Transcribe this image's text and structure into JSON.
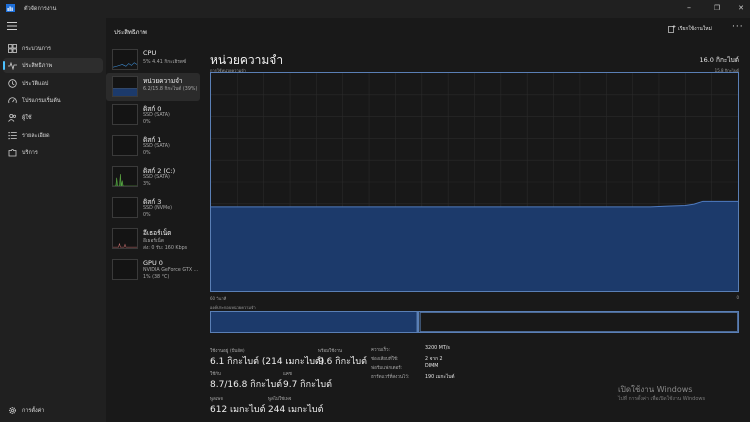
{
  "window": {
    "title": "ตัวจัดการงาน"
  },
  "nav": {
    "items": [
      {
        "label": "กระบวนการ",
        "icon": "grid-icon"
      },
      {
        "label": "ประสิทธิภาพ",
        "icon": "pulse-icon",
        "active": true
      },
      {
        "label": "ประวัติแอป",
        "icon": "history-icon"
      },
      {
        "label": "โปรแกรมเริ่มต้น",
        "icon": "speedometer-icon"
      },
      {
        "label": "ผู้ใช้",
        "icon": "users-icon"
      },
      {
        "label": "รายละเอียด",
        "icon": "list-icon"
      },
      {
        "label": "บริการ",
        "icon": "puzzle-icon"
      }
    ],
    "settings_label": "การตั้งค่า"
  },
  "header": {
    "page_title": "ประสิทธิภาพ",
    "run_task_label": "เรียกใช้งานใหม่",
    "more": "···"
  },
  "perf_list": [
    {
      "name": "CPU",
      "sub1": "5%  4.41 กิกะเฮิรตซ์",
      "sub2": ""
    },
    {
      "name": "หน่วยความจำ",
      "sub1": "6.2/15.8 กิกะไบต์ (39%)",
      "sub2": ""
    },
    {
      "name": "ดิสก์ 0",
      "sub1": "SSD (SATA)",
      "sub2": "0%"
    },
    {
      "name": "ดิสก์ 1",
      "sub1": "SSD (SATA)",
      "sub2": "0%"
    },
    {
      "name": "ดิสก์ 2 (C:)",
      "sub1": "SSD (SATA)",
      "sub2": "3%"
    },
    {
      "name": "ดิสก์ 3",
      "sub1": "SSD (NVMe)",
      "sub2": "0%"
    },
    {
      "name": "อีเธอร์เน็ต",
      "sub1": "อีเธอร์เน็ต",
      "sub2": "ส่ง: 0  รับ: 160 Kbps"
    },
    {
      "name": "GPU 0",
      "sub1": "NVIDIA GeForce GTX ...",
      "sub2": "1% (38 °C)"
    }
  ],
  "detail": {
    "title": "หน่วยความจำ",
    "total": "16.0 กิกะไบต์",
    "usage_label": "การใช้หน่วยความจำ",
    "usage_max": "15.8 กิกะไบต์",
    "time_left": "60 วินาที",
    "time_right": "0",
    "composition_label": "องค์ประกอบหน่วยความจำ"
  },
  "stats": {
    "in_use_label": "ใช้งานอยู่ (บีบอัด)",
    "in_use_value": "6.1 กิกะไบต์ (214 เมกะไบต์)",
    "available_label": "พร้อมใช้งาน",
    "available_value": "9.6 กิกะไบต์",
    "committed_label": "ใช้กับ",
    "committed_value": "8.7/16.8 กิกะไบต์",
    "cached_label": "แคช",
    "cached_value": "9.7 กิกะไบต์",
    "paged_label": "พูลเพจ",
    "paged_value": "612 เมกะไบต์",
    "nonpaged_label": "พูลไม่ใช่เพจ",
    "nonpaged_value": "244 เมกะไบต์"
  },
  "specs": [
    {
      "label": "ความเร็ว:",
      "value": "3200 MT/s"
    },
    {
      "label": "ช่องเสียบที่ใช้:",
      "value": "2 จาก 2"
    },
    {
      "label": "ฟอร์มแฟกเตอร์:",
      "value": "DIMM"
    },
    {
      "label": "ฮาร์ดแวร์ที่สงวนไว้:",
      "value": "190 เมกะไบต์"
    }
  ],
  "watermark": {
    "line1": "เปิดใช้งาน Windows",
    "line2": "ไปที่ การตั้งค่า เพื่อเปิดใช้งาน Windows"
  },
  "chart_data": {
    "type": "area",
    "title": "การใช้หน่วยความจำ",
    "xlabel": "60 วินาที → 0",
    "ylabel": "",
    "ylim": [
      0,
      15.8
    ],
    "x": [
      60,
      55,
      50,
      45,
      40,
      35,
      30,
      25,
      20,
      15,
      10,
      8,
      6,
      5,
      4,
      2,
      0
    ],
    "values": [
      6.1,
      6.1,
      6.1,
      6.1,
      6.1,
      6.1,
      6.1,
      6.1,
      6.1,
      6.1,
      6.1,
      6.15,
      6.2,
      6.3,
      6.5,
      6.5,
      6.5
    ],
    "grid": true,
    "color": "#1c3a6b",
    "line_color": "#4f7bc0"
  },
  "composition": {
    "in_use_fraction": 0.39,
    "modified_fraction": 0.005,
    "color": "#1c3a6b"
  },
  "colors": {
    "accent": "#4cc2ff",
    "chart_border": "#5a7fb5",
    "chart_fill": "#1c3a6b",
    "background": "#191919"
  }
}
